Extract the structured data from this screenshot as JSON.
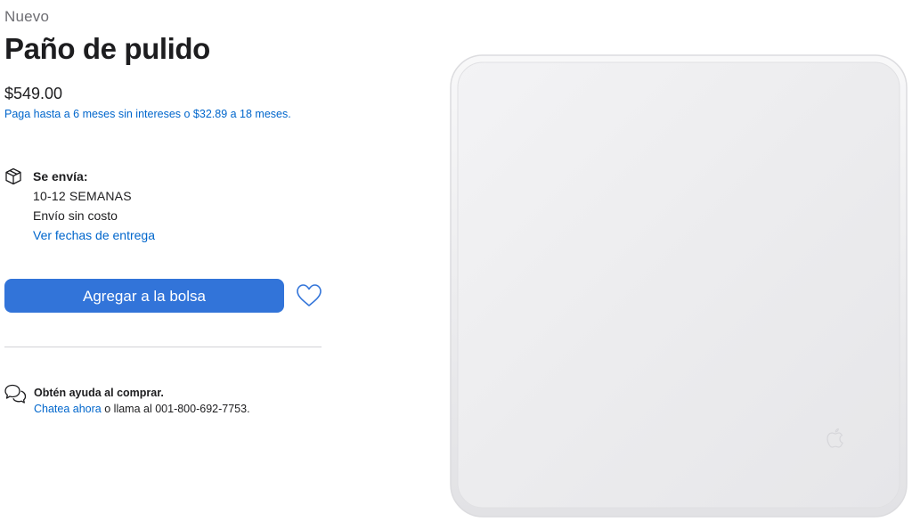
{
  "product": {
    "badge": "Nuevo",
    "title": "Paño de pulido",
    "price": "$549.00",
    "financing": "Paga hasta a 6 meses sin intereses o $32.89 a 18 meses."
  },
  "shipping": {
    "icon": "box-icon",
    "label": "Se envía:",
    "time": "10-12 SEMANAS",
    "cost": "Envío sin costo",
    "link": "Ver fechas de entrega"
  },
  "actions": {
    "add_to_bag": "Agregar a la bolsa",
    "favorite_icon": "heart-icon",
    "accent_color": "#3274d9"
  },
  "help": {
    "icon": "chat-bubbles-icon",
    "title": "Obtén ayuda al comprar.",
    "chat_link": "Chatea ahora",
    "call_text": " o llama al 001-800-692-7753."
  },
  "image": {
    "subject": "polishing-cloth",
    "logo_icon": "apple-logo-icon"
  }
}
